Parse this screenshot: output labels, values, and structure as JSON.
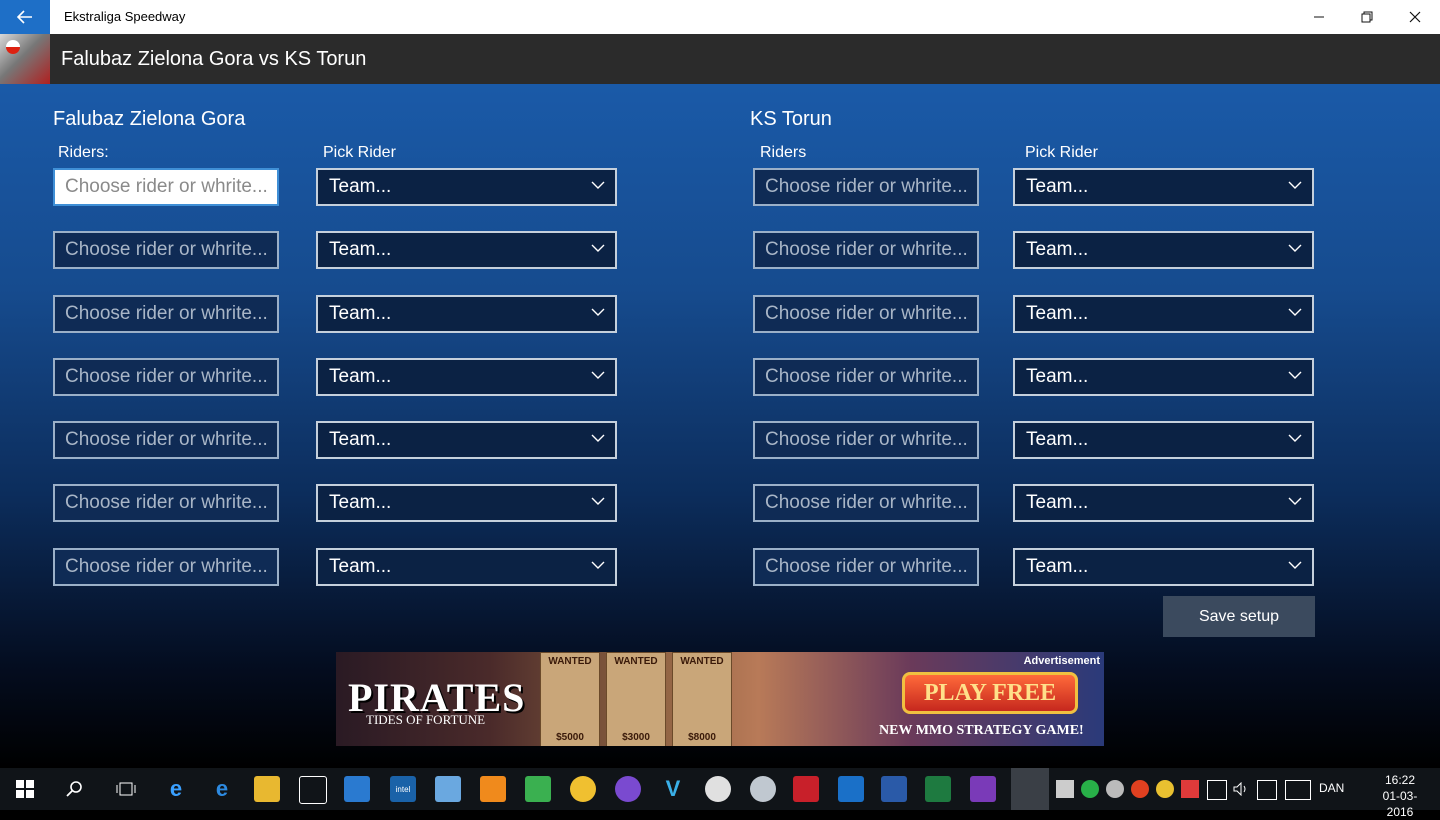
{
  "titlebar": {
    "app_title": "Ekstraliga Speedway",
    "back_icon": "back-arrow-icon",
    "controls": [
      "minimize-icon",
      "restore-icon",
      "close-icon"
    ]
  },
  "header": {
    "page_title": "Falubaz Zielona Gora vs KS Torun",
    "logo_icon": "ekstraliga-logo"
  },
  "home": {
    "team_name": "Falubaz Zielona Gora",
    "riders_label": "Riders:",
    "pick_label": "Pick Rider",
    "rows": [
      {
        "placeholder": "Choose rider or whrite...",
        "team": "Team..."
      },
      {
        "placeholder": "Choose rider or whrite...",
        "team": "Team..."
      },
      {
        "placeholder": "Choose rider or whrite...",
        "team": "Team..."
      },
      {
        "placeholder": "Choose rider or whrite...",
        "team": "Team..."
      },
      {
        "placeholder": "Choose rider or whrite...",
        "team": "Team..."
      },
      {
        "placeholder": "Choose rider or whrite...",
        "team": "Team..."
      },
      {
        "placeholder": "Choose rider or whrite...",
        "team": "Team..."
      }
    ]
  },
  "away": {
    "team_name": "KS Torun",
    "riders_label": "Riders",
    "pick_label": "Pick Rider",
    "rows": [
      {
        "placeholder": "Choose rider or whrite...",
        "team": "Team..."
      },
      {
        "placeholder": "Choose rider or whrite...",
        "team": "Team..."
      },
      {
        "placeholder": "Choose rider or whrite...",
        "team": "Team..."
      },
      {
        "placeholder": "Choose rider or whrite...",
        "team": "Team..."
      },
      {
        "placeholder": "Choose rider or whrite...",
        "team": "Team..."
      },
      {
        "placeholder": "Choose rider or whrite...",
        "team": "Team..."
      },
      {
        "placeholder": "Choose rider or whrite...",
        "team": "Team..."
      }
    ]
  },
  "save_label": "Save setup",
  "ad": {
    "label": "Advertisement",
    "title": "PIRATES",
    "subtitle": "TIDES OF FORTUNE",
    "cta": "PLAY FREE",
    "tagline": "NEW MMO STRATEGY GAME!",
    "posters": [
      {
        "header": "WANTED",
        "price": "$5000"
      },
      {
        "header": "WANTED",
        "price": "$3000"
      },
      {
        "header": "WANTED",
        "price": "$8000"
      }
    ]
  },
  "taskbar": {
    "icons": [
      "windows-start-icon",
      "search-icon",
      "task-view-icon",
      "internet-explorer-icon",
      "edge-icon",
      "file-explorer-icon",
      "store-icon",
      "app-icon",
      "intel-icon",
      "app-icon",
      "app-icon",
      "app-icon",
      "app-icon",
      "app-icon",
      "vimeo-icon",
      "app-icon",
      "app-icon",
      "acrobat-icon",
      "outlook-icon",
      "word-icon",
      "excel-icon",
      "visual-studio-icon",
      "speedway-app-icon"
    ],
    "language": "DAN",
    "time": "16:22",
    "date": "01-03-2016"
  },
  "colors": {
    "accent": "#1e6fc7",
    "header_bg": "#2b2b2b",
    "main_top": "#1a5aa8",
    "save_btn": "#3b4a5e"
  }
}
